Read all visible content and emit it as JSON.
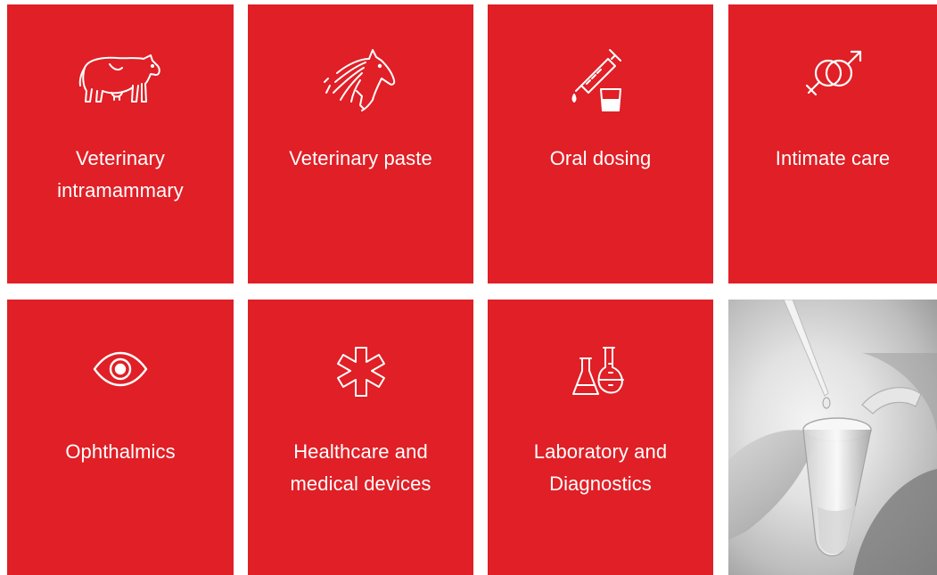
{
  "tiles": [
    {
      "label": "Veterinary\nintramammary",
      "icon": "cow-icon"
    },
    {
      "label": "Veterinary paste",
      "icon": "horse-head-icon"
    },
    {
      "label": "Oral dosing",
      "icon": "syringe-cup-icon"
    },
    {
      "label": "Intimate care",
      "icon": "gender-symbols-icon"
    },
    {
      "label": "Ophthalmics",
      "icon": "eye-icon"
    },
    {
      "label": "Healthcare and\nmedical devices",
      "icon": "medical-star-icon"
    },
    {
      "label": "Laboratory and\nDiagnostics",
      "icon": "lab-flasks-icon"
    }
  ],
  "colors": {
    "tile_background": "#e01f26",
    "tile_text": "#ffffff"
  }
}
